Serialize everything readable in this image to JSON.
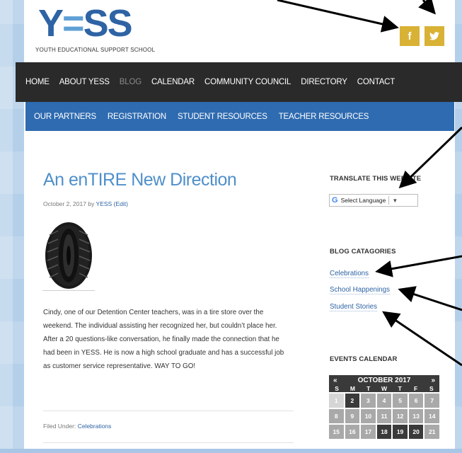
{
  "header": {
    "logo_text": "YESS",
    "logo_sub": "YOUTH EDUCATIONAL SUPPORT SCHOOL",
    "social": {
      "facebook": "f",
      "twitter": "t"
    }
  },
  "nav_primary": [
    "HOME",
    "ABOUT YESS",
    "BLOG",
    "CALENDAR",
    "COMMUNITY COUNCIL",
    "DIRECTORY",
    "CONTACT"
  ],
  "nav_primary_active": "BLOG",
  "nav_secondary": [
    "OUR PARTNERS",
    "REGISTRATION",
    "STUDENT RESOURCES",
    "TEACHER RESOURCES"
  ],
  "post": {
    "title": "An enTIRE New Direction",
    "date": "October 2, 2017",
    "by": "by",
    "author": "YESS",
    "edit": "(Edit)",
    "body": "Cindy, one of our Detention Center teachers, was in a tire store over the weekend.  The individual assisting her recognized her, but couldn’t place her.  After a 20 questions-like conversation, he finally made the connection that he had been in YESS.  He is now a high school graduate and has a successful job as customer service representative.  WAY TO GO!",
    "filed_label": "Filed Under:",
    "filed_category": "Celebrations"
  },
  "sidebar": {
    "translate_title": "TRANSLATE THIS WEBSITE",
    "translate_select": "Select Language",
    "categories_title": "BLOG CATAGORIES",
    "categories": [
      "Celebrations",
      "School Happenings",
      "Student Stories"
    ],
    "events_title": "EVENTS CALENDAR"
  },
  "calendar": {
    "prev": "«",
    "month": "OCTOBER 2017",
    "next": "»",
    "weekdays": [
      "S",
      "M",
      "T",
      "W",
      "T",
      "F",
      "S"
    ],
    "days": [
      "1",
      "2",
      "3",
      "4",
      "5",
      "6",
      "7",
      "8",
      "9",
      "10",
      "11",
      "12",
      "13",
      "14",
      "15",
      "16",
      "17",
      "18",
      "19",
      "20",
      "21"
    ],
    "today": "2",
    "event_days": [
      "18",
      "19",
      "20"
    ]
  },
  "colors": {
    "brand_blue": "#2e63a4",
    "light_blue": "#5fa0d6",
    "secondary_nav": "#2f6bb0",
    "primary_nav": "#2a2a2a",
    "social_gold": "#d9b235"
  }
}
